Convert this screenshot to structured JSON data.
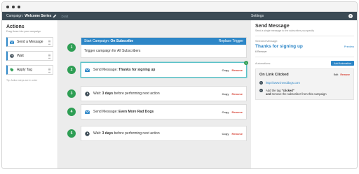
{
  "topbar": {
    "campaign_label": "Campaign:",
    "campaign_name": "Welcome Series",
    "draft": "Draft",
    "settings": "Settings",
    "help": "?"
  },
  "sidebar": {
    "title": "Actions",
    "subtitle": "Drag these into your campaign",
    "items": [
      {
        "label": "Send a Message",
        "icon": "envelope-icon"
      },
      {
        "label": "Wait",
        "icon": "clock-icon"
      },
      {
        "label": "Apply Tag",
        "icon": "tag-icon"
      }
    ],
    "tip": "Tip: Action steps are in order"
  },
  "canvas": {
    "trigger": {
      "badge": "1",
      "title_prefix": "Start Campaign:",
      "title_name": "On Subscribe",
      "replace": "Replace Trigger",
      "body": "Trigger campaign for All Subscribers"
    },
    "steps": [
      {
        "badge": "2",
        "icon": "envelope-icon",
        "prefix": "Send Message:",
        "bold": "Thanks for signing up",
        "suffix": "",
        "copy": "Copy",
        "remove": "Remove",
        "selected": true,
        "sel_count": "1"
      },
      {
        "badge": "3",
        "icon": "clock-icon",
        "prefix": "Wait:",
        "bold": "3 days",
        "suffix": "before performing next action",
        "copy": "Copy",
        "remove": "Remove",
        "selected": false
      },
      {
        "badge": "4",
        "icon": "envelope-icon",
        "prefix": "Send Message:",
        "bold": "Even More Rad Dogs",
        "suffix": "",
        "copy": "Copy",
        "remove": "Remove",
        "selected": false
      },
      {
        "badge": "5",
        "icon": "clock-icon",
        "prefix": "Wait:",
        "bold": "3 days",
        "suffix": "before performing next action",
        "copy": "Copy",
        "remove": "Remove",
        "selected": false
      }
    ]
  },
  "panel": {
    "title": "Send Message",
    "subtitle": "Send a single message to the subscriber you specify",
    "selected_label": "Selected Message:",
    "message_title": "Thanks for signing up",
    "preview": "Preview",
    "meta": "6 Remove",
    "automations_label": "Automations:",
    "add_button": "Add Automation",
    "auto_title": "On Link Clicked",
    "auto_edit": "Edit",
    "auto_remove": "Remove",
    "auto_link": "http://www.ineeddogs.com",
    "auto_tag_prefix": "Add the tag",
    "auto_tag_name": "\"clicked\"",
    "auto_tag_suffix_bold": "and",
    "auto_tag_suffix": "remove the subscriber from this campaign"
  },
  "colors": {
    "accent": "#2d86c7",
    "topbar": "#3c4b55",
    "badge": "#2e9e54",
    "remove": "#d64033",
    "selected": "#5ac2c8"
  }
}
